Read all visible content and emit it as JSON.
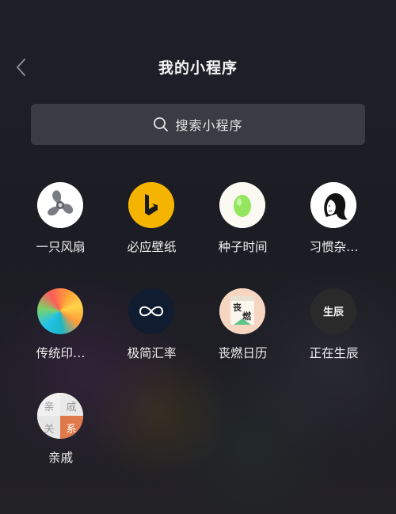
{
  "header": {
    "back_icon": "chevron-left-icon",
    "title": "我的小程序"
  },
  "search": {
    "icon": "search-icon",
    "placeholder": "搜索小程序"
  },
  "apps": [
    {
      "label": "一只风扇",
      "icon": "fan-icon"
    },
    {
      "label": "必应壁纸",
      "icon": "bing-logo-icon",
      "accent": "#f5b400"
    },
    {
      "label": "种子时间",
      "icon": "seed-icon",
      "accent": "#8fe35a"
    },
    {
      "label": "习惯杂…",
      "icon": "girl-portrait-icon"
    },
    {
      "label": "传统印…",
      "icon": "color-wheel-icon"
    },
    {
      "label": "极简汇率",
      "icon": "infinity-icon",
      "accent": "#101c30"
    },
    {
      "label": "丧燃日历",
      "icon": "calendar-icon",
      "icon_text": [
        "丧",
        "燃"
      ]
    },
    {
      "label": "正在生辰",
      "icon": "birthday-text-icon",
      "icon_text": "生辰"
    },
    {
      "label": "亲戚",
      "icon": "relatives-icon",
      "icon_text": [
        "亲",
        "戚",
        "关",
        "系"
      ]
    }
  ],
  "colors": {
    "search_bg": "#3a3b43",
    "text": "#f0f0f0"
  }
}
